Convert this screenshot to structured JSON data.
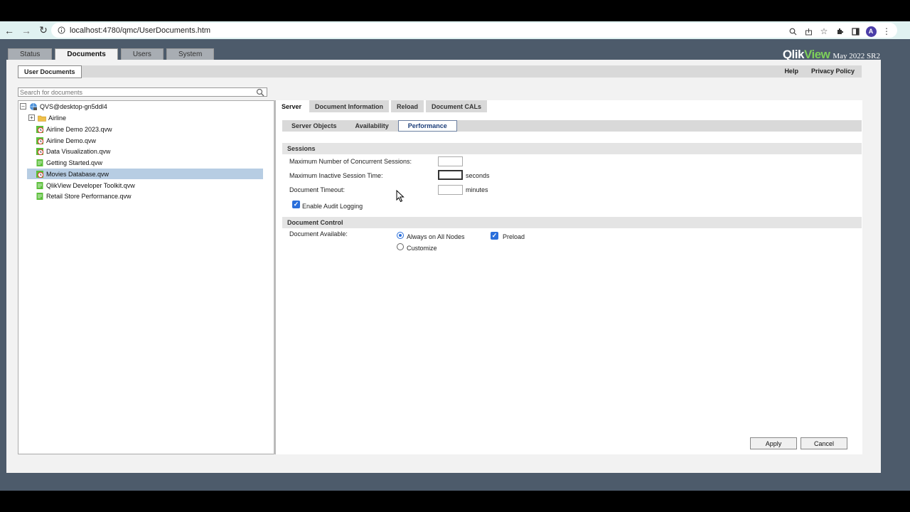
{
  "browser": {
    "url": "localhost:4780/qmc/UserDocuments.htm",
    "avatar_letter": "A"
  },
  "app": {
    "top_tabs": [
      "Status",
      "Documents",
      "Users",
      "System"
    ],
    "brand_qlik": "Qlik",
    "brand_view": "View",
    "brand_version": "May 2022 SR2"
  },
  "header": {
    "title": "User Documents",
    "help": "Help",
    "privacy": "Privacy Policy"
  },
  "search": {
    "placeholder": "Search for documents"
  },
  "tree": {
    "server": "QVS@desktop-gn5ddl4",
    "folder": "Airline",
    "documents": [
      "Airline Demo 2023.qvw",
      "Airline Demo.qvw",
      "Data Visualization.qvw",
      "Getting Started.qvw",
      "Movies Database.qvw",
      "QlikView Developer Toolkit.qvw",
      "Retail Store Performance.qvw"
    ]
  },
  "tabs": [
    "Server",
    "Document Information",
    "Reload",
    "Document CALs"
  ],
  "subtabs": [
    "Server Objects",
    "Availability",
    "Performance"
  ],
  "sessions": {
    "title": "Sessions",
    "max_sessions_label": "Maximum Number of Concurrent Sessions:",
    "max_inactive_label": "Maximum Inactive Session Time:",
    "inactive_unit": "seconds",
    "timeout_label": "Document Timeout:",
    "timeout_unit": "minutes",
    "audit_label": "Enable Audit Logging"
  },
  "control": {
    "title": "Document Control",
    "available_label": "Document Available:",
    "always_label": "Always on All Nodes",
    "customize_label": "Customize",
    "preload_label": "Preload"
  },
  "buttons": {
    "apply": "Apply",
    "cancel": "Cancel"
  }
}
